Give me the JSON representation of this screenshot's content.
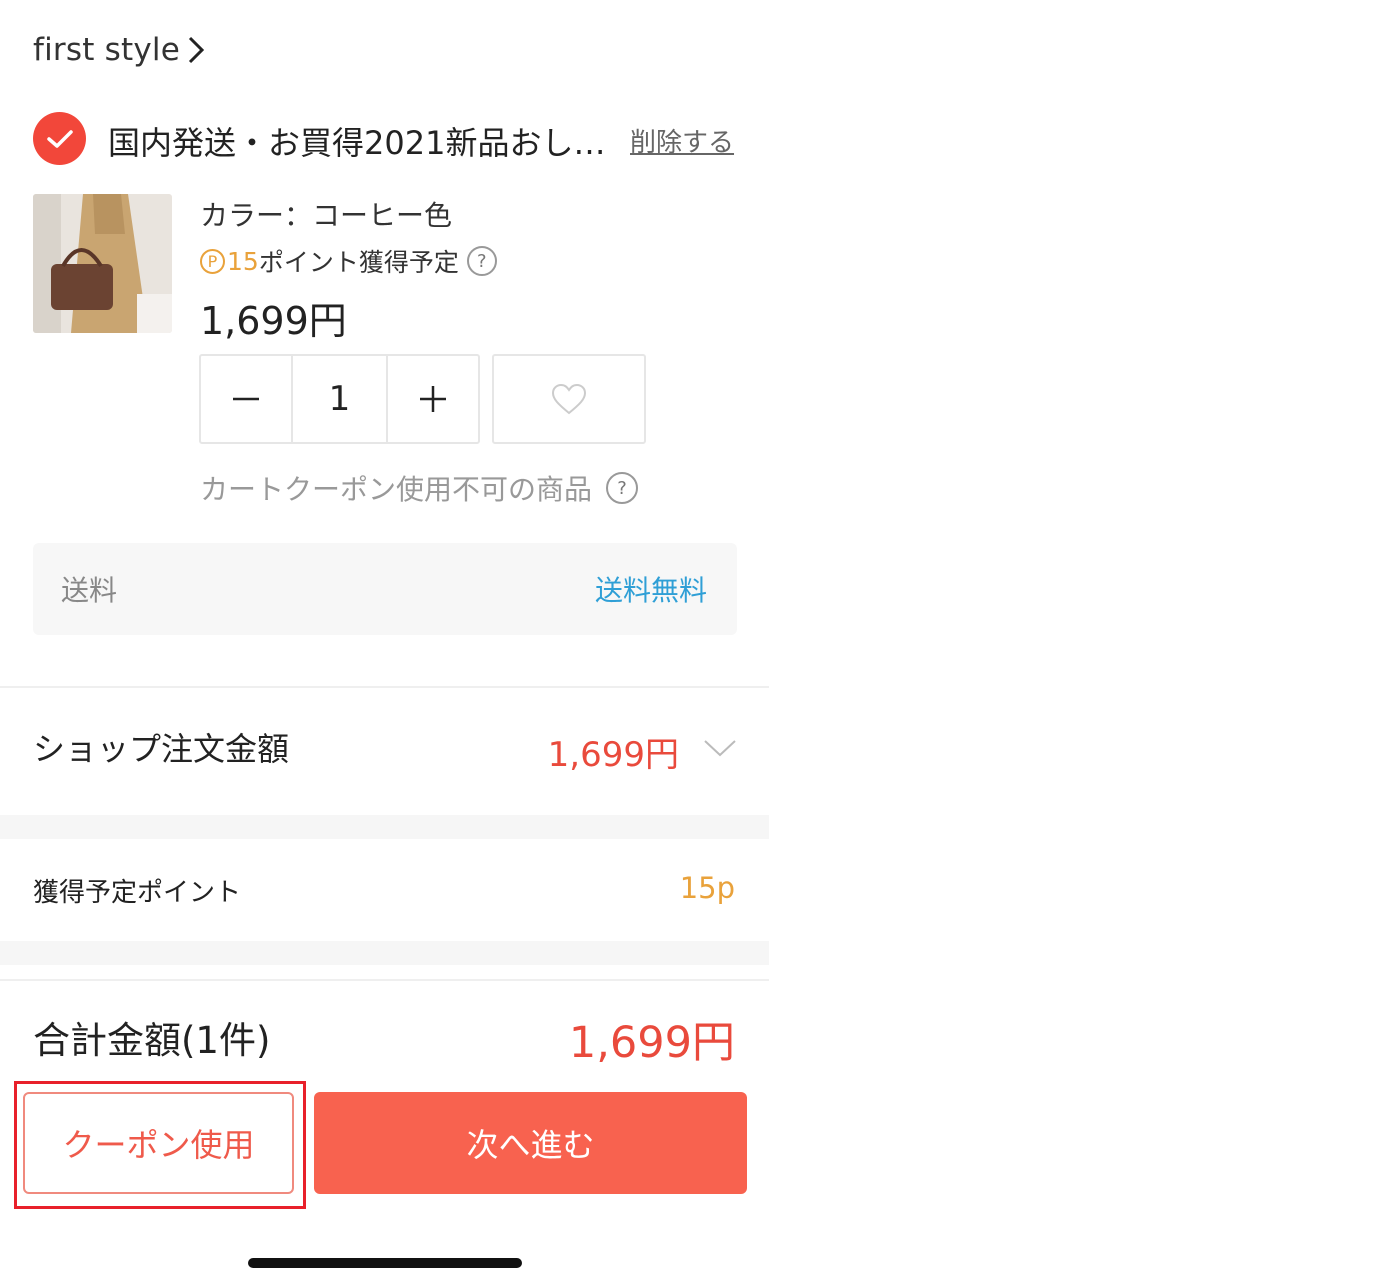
{
  "shop": {
    "name": "first style"
  },
  "product": {
    "title": "国内発送・お買得2021新品おし…",
    "delete_label": "削除する",
    "variant": "カラー：コーヒー色",
    "points_badge": "P",
    "points_num": "15",
    "points_text": "ポイント獲得予定",
    "price": "1,699円",
    "quantity": "1",
    "coupon_note": "カートクーポン使用不可の商品"
  },
  "shipping": {
    "label": "送料",
    "value": "送料無料"
  },
  "order": {
    "label": "ショップ注文金額",
    "amount": "1,699円"
  },
  "points": {
    "label": "獲得予定ポイント",
    "value": "15p"
  },
  "total": {
    "label": "合計金額(1件)",
    "amount": "1,699円"
  },
  "actions": {
    "coupon": "クーポン使用",
    "next": "次へ進む"
  },
  "help_glyph": "?",
  "colors": {
    "accent_red": "#f2473a",
    "price_red": "#e94a3c",
    "points_orange": "#e9a23b",
    "shipping_blue": "#2f9fd6",
    "next_button": "#f8624f"
  }
}
